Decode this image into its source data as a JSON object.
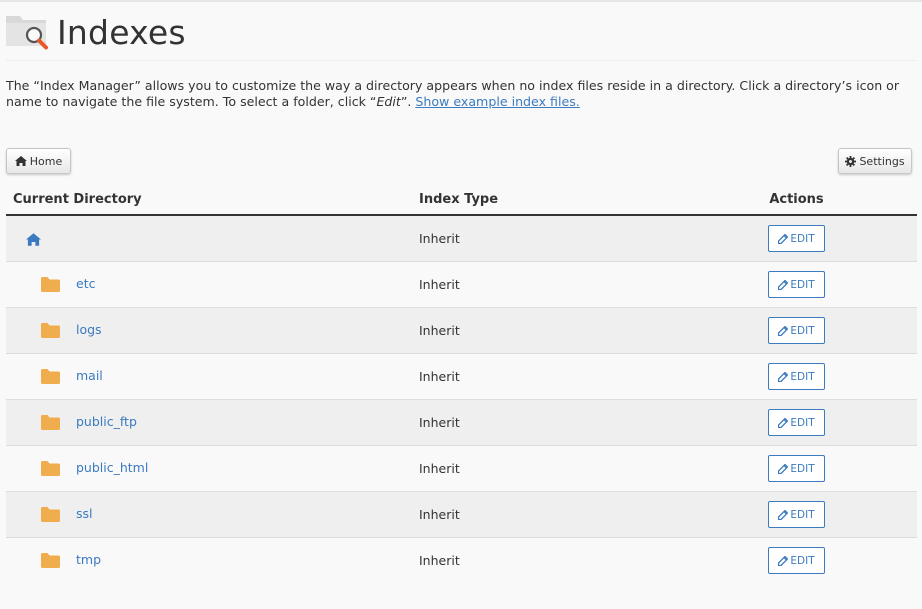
{
  "header": {
    "title": "Indexes",
    "icon": "folder-search-icon"
  },
  "description": {
    "text_before_edit": "The “Index Manager” allows you to customize the way a directory appears when no index files reside in a directory. Click a directory’s icon or name to navigate the file system. To select a folder, click “",
    "edit_word": "Edit",
    "text_after_edit": "”. ",
    "link": "Show example index files."
  },
  "toolbar": {
    "home_label": "Home",
    "settings_label": "Settings"
  },
  "table": {
    "headers": {
      "directory": "Current Directory",
      "index_type": "Index Type",
      "actions": "Actions"
    },
    "rows": [
      {
        "name": "",
        "icon": "home-icon",
        "index_type": "Inherit",
        "action": "EDIT"
      },
      {
        "name": "etc",
        "icon": "folder-icon",
        "index_type": "Inherit",
        "action": "EDIT"
      },
      {
        "name": "logs",
        "icon": "folder-icon",
        "index_type": "Inherit",
        "action": "EDIT"
      },
      {
        "name": "mail",
        "icon": "folder-icon",
        "index_type": "Inherit",
        "action": "EDIT"
      },
      {
        "name": "public_ftp",
        "icon": "folder-icon",
        "index_type": "Inherit",
        "action": "EDIT"
      },
      {
        "name": "public_html",
        "icon": "folder-icon",
        "index_type": "Inherit",
        "action": "EDIT"
      },
      {
        "name": "ssl",
        "icon": "folder-icon",
        "index_type": "Inherit",
        "action": "EDIT"
      },
      {
        "name": "tmp",
        "icon": "folder-icon",
        "index_type": "Inherit",
        "action": "EDIT"
      }
    ]
  },
  "colors": {
    "link": "#3a7ac0",
    "folder": "#f0ad4e",
    "accent_icon": "#e8562a"
  }
}
